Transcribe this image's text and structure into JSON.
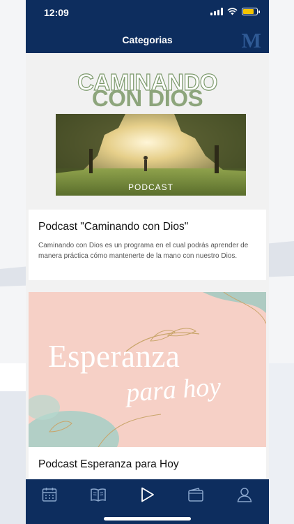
{
  "status_bar": {
    "time": "12:09",
    "icons": [
      "signal-icon",
      "wifi-icon",
      "battery-icon"
    ],
    "battery_color": "#f5c400"
  },
  "header": {
    "title": "Categorias",
    "logo": "M",
    "bg_color": "#0d2d5e"
  },
  "cards": [
    {
      "artwork_title_line1": "CAMINANDO",
      "artwork_title_line2": "CON DIOS",
      "artwork_caption": "PODCAST",
      "title": "Podcast \"Caminando con Dios\"",
      "description": "Caminando con Dios es un programa en el cual podrás aprender de manera práctica cómo mantenerte de la mano con nuestro Dios."
    },
    {
      "artwork_title_line1": "Esperanza",
      "artwork_title_line2": "para hoy",
      "title": "Podcast Esperanza para Hoy"
    }
  ],
  "tab_bar": {
    "tabs": [
      {
        "icon": "calendar-icon"
      },
      {
        "icon": "book-icon"
      },
      {
        "icon": "play-icon"
      },
      {
        "icon": "wallet-icon"
      },
      {
        "icon": "profile-icon"
      }
    ]
  }
}
